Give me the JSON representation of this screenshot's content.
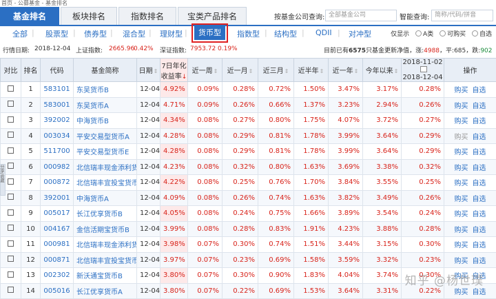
{
  "breadcrumb": "首页 - 公募基金 - 基金排名",
  "tabs": [
    "基金排名",
    "板块排名",
    "指数排名",
    "宝类产品排名"
  ],
  "search": {
    "company_label": "按基金公司查询:",
    "company_placeholder": "全部基金公司",
    "smart_label": "智能查询:",
    "smart_placeholder": "简称/代码/拼音"
  },
  "filters": [
    "全部",
    "股票型",
    "债券型",
    "混合型",
    "理财型",
    "货币型",
    "指数型",
    "结构型",
    "QDII",
    "对冲型"
  ],
  "active_filter": "货币型",
  "radio": {
    "label": "仅显示",
    "options": [
      "A类",
      "可购买",
      "自选"
    ]
  },
  "market": {
    "date_label": "行情日期:",
    "date": "2018-12-04",
    "sh_label": "上证指数:",
    "sh_value": "2665.96",
    "sh_change": "0.42%",
    "sz_label": "深证指数:",
    "sz_value": "7953.72",
    "sz_change": "0.19%",
    "summary_prefix": "目前已有",
    "summary_count": "6575",
    "summary_mid": "只基金更新净值，涨:",
    "up_count": "4988",
    "flat_label": "，平:",
    "flat_count": "685",
    "down_label": "，跌:",
    "down_count": "902"
  },
  "columns": {
    "compare": "对比",
    "rank": "排名",
    "code": "代码",
    "name": "基金简称",
    "date": "日期",
    "yield_line1": "7日年化",
    "yield_line2": "收益率",
    "week": "近一周",
    "month": "近一月",
    "three_month": "近三月",
    "half_year": "近半年",
    "year": "近一年",
    "ytd": "今年以来",
    "custom_from": "2018-11-02",
    "custom_to": "2018-12-04",
    "action": "操作"
  },
  "actions": {
    "buy": "购买",
    "watch": "自选"
  },
  "rows": [
    {
      "rank": "1",
      "code": "583101",
      "name": "东吴货币B",
      "date": "12-04",
      "yield7": "4.92%",
      "week": "0.09%",
      "month": "0.28%",
      "m3": "0.72%",
      "m6": "1.50%",
      "y1": "3.47%",
      "ytd": "3.17%",
      "custom": "0.28%"
    },
    {
      "rank": "2",
      "code": "583001",
      "name": "东吴货币A",
      "date": "12-04",
      "yield7": "4.71%",
      "week": "0.09%",
      "month": "0.26%",
      "m3": "0.66%",
      "m6": "1.37%",
      "y1": "3.23%",
      "ytd": "2.94%",
      "custom": "0.26%"
    },
    {
      "rank": "3",
      "code": "392002",
      "name": "中海货币B",
      "date": "12-04",
      "yield7": "4.34%",
      "week": "0.08%",
      "month": "0.27%",
      "m3": "0.80%",
      "m6": "1.75%",
      "y1": "4.07%",
      "ytd": "3.72%",
      "custom": "0.27%"
    },
    {
      "rank": "4",
      "code": "003034",
      "name": "平安交易型货币A",
      "date": "12-04",
      "yield7": "4.28%",
      "week": "0.08%",
      "month": "0.29%",
      "m3": "0.81%",
      "m6": "1.78%",
      "y1": "3.99%",
      "ytd": "3.64%",
      "custom": "0.29%",
      "dim": true
    },
    {
      "rank": "5",
      "code": "511700",
      "name": "平安交易型货币E",
      "date": "12-04",
      "yield7": "4.28%",
      "week": "0.08%",
      "month": "0.29%",
      "m3": "0.81%",
      "m6": "1.78%",
      "y1": "3.99%",
      "ytd": "3.64%",
      "custom": "0.29%"
    },
    {
      "rank": "6",
      "code": "000982",
      "name": "北信瑞丰现金添利货",
      "date": "12-04",
      "yield7": "4.23%",
      "week": "0.08%",
      "month": "0.32%",
      "m3": "0.80%",
      "m6": "1.63%",
      "y1": "3.69%",
      "ytd": "3.38%",
      "custom": "0.32%"
    },
    {
      "rank": "7",
      "code": "000872",
      "name": "北信瑞丰宜投宝货币B",
      "date": "12-04",
      "yield7": "4.22%",
      "week": "0.08%",
      "month": "0.25%",
      "m3": "0.76%",
      "m6": "1.70%",
      "y1": "3.84%",
      "ytd": "3.55%",
      "custom": "0.25%"
    },
    {
      "rank": "8",
      "code": "392001",
      "name": "中海货币A",
      "date": "12-04",
      "yield7": "4.09%",
      "week": "0.08%",
      "month": "0.26%",
      "m3": "0.74%",
      "m6": "1.63%",
      "y1": "3.82%",
      "ytd": "3.49%",
      "custom": "0.26%"
    },
    {
      "rank": "9",
      "code": "005017",
      "name": "长江优享货币B",
      "date": "12-04",
      "yield7": "4.05%",
      "week": "0.08%",
      "month": "0.24%",
      "m3": "0.75%",
      "m6": "1.66%",
      "y1": "3.89%",
      "ytd": "3.54%",
      "custom": "0.24%"
    },
    {
      "rank": "10",
      "code": "004167",
      "name": "金信活期宝货币B",
      "date": "12-04",
      "yield7": "3.99%",
      "week": "0.08%",
      "month": "0.28%",
      "m3": "0.83%",
      "m6": "1.91%",
      "y1": "4.23%",
      "ytd": "3.88%",
      "custom": "0.28%"
    },
    {
      "rank": "11",
      "code": "000981",
      "name": "北信瑞丰现金添利货",
      "date": "12-04",
      "yield7": "3.98%",
      "week": "0.07%",
      "month": "0.30%",
      "m3": "0.74%",
      "m6": "1.51%",
      "y1": "3.44%",
      "ytd": "3.15%",
      "custom": "0.30%"
    },
    {
      "rank": "12",
      "code": "000871",
      "name": "北信瑞丰宜投宝货币A",
      "date": "12-04",
      "yield7": "3.97%",
      "week": "0.07%",
      "month": "0.23%",
      "m3": "0.69%",
      "m6": "1.58%",
      "y1": "3.59%",
      "ytd": "3.32%",
      "custom": "0.23%"
    },
    {
      "rank": "13",
      "code": "002302",
      "name": "新沃通宝货币B",
      "date": "12-04",
      "yield7": "3.80%",
      "week": "0.07%",
      "month": "0.30%",
      "m3": "0.90%",
      "m6": "1.83%",
      "y1": "4.04%",
      "ytd": "3.74%",
      "custom": "0.30%"
    },
    {
      "rank": "14",
      "code": "005016",
      "name": "长江优享货币A",
      "date": "12-04",
      "yield7": "3.80%",
      "week": "0.07%",
      "month": "0.22%",
      "m3": "0.69%",
      "m6": "1.53%",
      "y1": "3.64%",
      "ytd": "3.31%",
      "custom": "0.22%"
    }
  ],
  "side_tab": "分享/收藏",
  "watermark": "知乎 @杨世璞"
}
